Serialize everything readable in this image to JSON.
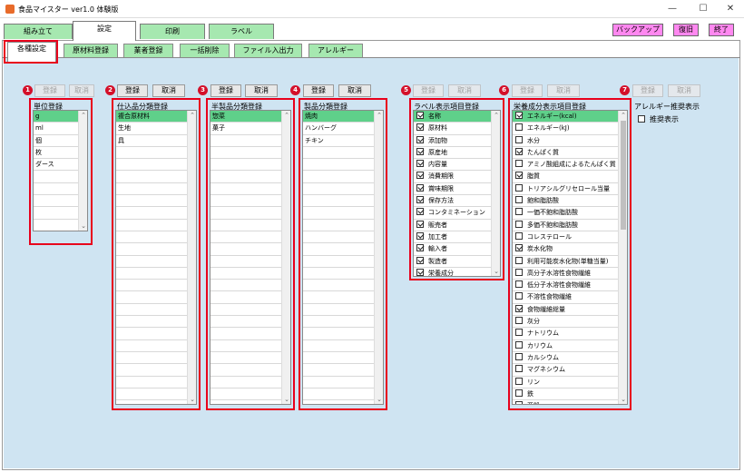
{
  "window": {
    "title": "食品マイスター ver1.0 体験版",
    "minimize": "—",
    "maximize": "☐",
    "close": "✕"
  },
  "main_tabs": [
    "組み立て",
    "設定",
    "印刷",
    "ラベル"
  ],
  "top_buttons": {
    "backup": "バックアップ",
    "restore": "復旧",
    "exit": "終了"
  },
  "sub_tabs": [
    "各種設定",
    "原材料登録",
    "業者登録",
    "一括削除",
    "ファイル入出力",
    "アレルギー"
  ],
  "common": {
    "register": "登録",
    "cancel": "取消"
  },
  "panels": {
    "unit": {
      "badge": "1",
      "title": "単位登録",
      "items": [
        "g",
        "ml",
        "個",
        "枚",
        "ダース",
        "",
        "",
        "",
        "",
        ""
      ]
    },
    "shikomi": {
      "badge": "2",
      "title": "仕込品分類登録",
      "items": [
        "複合原材料",
        "生地",
        "具",
        "",
        "",
        "",
        "",
        "",
        "",
        "",
        "",
        "",
        "",
        "",
        "",
        "",
        "",
        "",
        "",
        "",
        "",
        "",
        "",
        "",
        ""
      ]
    },
    "hanseihin": {
      "badge": "3",
      "title": "半製品分類登録",
      "items": [
        "惣菜",
        "菓子",
        "",
        "",
        "",
        "",
        "",
        "",
        "",
        "",
        "",
        "",
        "",
        "",
        "",
        "",
        "",
        "",
        "",
        "",
        "",
        "",
        "",
        "",
        ""
      ]
    },
    "seihin": {
      "badge": "4",
      "title": "製品分類登録",
      "items": [
        "焼肉",
        "ハンバーグ",
        "チキン",
        "",
        "",
        "",
        "",
        "",
        "",
        "",
        "",
        "",
        "",
        "",
        "",
        "",
        "",
        "",
        "",
        "",
        "",
        "",
        "",
        "",
        ""
      ]
    },
    "label_items": {
      "badge": "5",
      "title": "ラベル表示項目登録",
      "items": [
        {
          "label": "名称",
          "checked": true
        },
        {
          "label": "原材料",
          "checked": true
        },
        {
          "label": "添加物",
          "checked": true
        },
        {
          "label": "原産地",
          "checked": true
        },
        {
          "label": "内容量",
          "checked": true
        },
        {
          "label": "消費期限",
          "checked": true
        },
        {
          "label": "賞味期限",
          "checked": true
        },
        {
          "label": "保存方法",
          "checked": true
        },
        {
          "label": "コンタミネーション",
          "checked": true
        },
        {
          "label": "販売者",
          "checked": true
        },
        {
          "label": "加工者",
          "checked": true
        },
        {
          "label": "輸入者",
          "checked": true
        },
        {
          "label": "製造者",
          "checked": true
        },
        {
          "label": "栄養成分",
          "checked": true
        }
      ]
    },
    "nutrition": {
      "badge": "6",
      "title": "栄養成分表示項目登録",
      "items": [
        {
          "label": "エネルギー(kcal)",
          "checked": true
        },
        {
          "label": "エネルギー(kJ)",
          "checked": false
        },
        {
          "label": "水分",
          "checked": false
        },
        {
          "label": "たんぱく質",
          "checked": true
        },
        {
          "label": "アミノ酸組成によるたんぱく質",
          "checked": false
        },
        {
          "label": "脂質",
          "checked": true
        },
        {
          "label": "トリアシルグリセロール当量",
          "checked": false
        },
        {
          "label": "飽和脂肪酸",
          "checked": false
        },
        {
          "label": "一価不飽和脂肪酸",
          "checked": false
        },
        {
          "label": "多価不飽和脂肪酸",
          "checked": false
        },
        {
          "label": "コレステロール",
          "checked": false
        },
        {
          "label": "炭水化物",
          "checked": true
        },
        {
          "label": "利用可能炭水化物(単糖当量)",
          "checked": false
        },
        {
          "label": "高分子水溶性食物繊維",
          "checked": false
        },
        {
          "label": "低分子水溶性食物繊維",
          "checked": false
        },
        {
          "label": "不溶性食物繊維",
          "checked": false
        },
        {
          "label": "食物繊維総量",
          "checked": true
        },
        {
          "label": "灰分",
          "checked": false
        },
        {
          "label": "ナトリウム",
          "checked": false
        },
        {
          "label": "カリウム",
          "checked": false
        },
        {
          "label": "カルシウム",
          "checked": false
        },
        {
          "label": "マグネシウム",
          "checked": false
        },
        {
          "label": "リン",
          "checked": false
        },
        {
          "label": "鉄",
          "checked": false
        },
        {
          "label": "亜鉛",
          "checked": false
        }
      ]
    },
    "allergy": {
      "badge": "7",
      "title": "アレルギー推奨表示",
      "checkbox_label": "推奨表示",
      "checked": false
    }
  }
}
